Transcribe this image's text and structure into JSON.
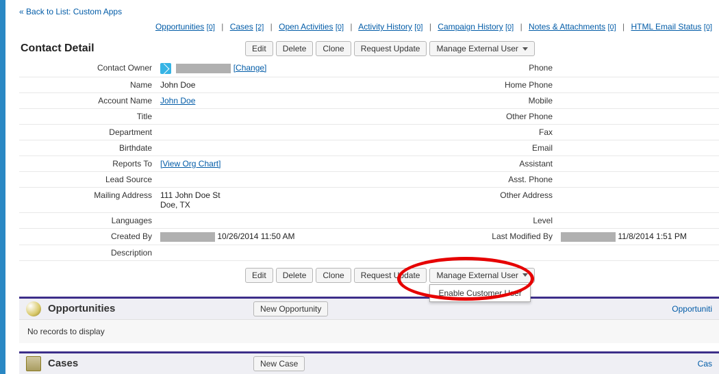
{
  "back_link": {
    "arrow": "«",
    "label": "Back to List: Custom Apps"
  },
  "related_nav": [
    {
      "label": "Opportunities",
      "count": "[0]"
    },
    {
      "label": "Cases",
      "count": "[2]"
    },
    {
      "label": "Open Activities",
      "count": "[0]"
    },
    {
      "label": "Activity History",
      "count": "[0]"
    },
    {
      "label": "Campaign History",
      "count": "[0]"
    },
    {
      "label": "Notes & Attachments",
      "count": "[0]"
    },
    {
      "label": "HTML Email Status",
      "count": "[0]"
    }
  ],
  "section_title": "Contact Detail",
  "buttons": {
    "edit": "Edit",
    "delete": "Delete",
    "clone": "Clone",
    "request_update": "Request Update",
    "manage_external": "Manage External User"
  },
  "dropdown": {
    "enable_customer_user": "Enable Customer User"
  },
  "fields": {
    "contact_owner_label": "Contact Owner",
    "change_link": "[Change]",
    "name_label": "Name",
    "name_value": "John Doe",
    "account_name_label": "Account Name",
    "account_name_value": "John Doe",
    "title_label": "Title",
    "department_label": "Department",
    "birthdate_label": "Birthdate",
    "reports_to_label": "Reports To",
    "reports_to_value": "[View Org Chart]",
    "lead_source_label": "Lead Source",
    "mailing_address_label": "Mailing Address",
    "mailing_address_value_l1": "111 John Doe St",
    "mailing_address_value_l2": "Doe, TX",
    "languages_label": "Languages",
    "created_by_label": "Created By",
    "created_by_value": "10/26/2014 11:50 AM",
    "description_label": "Description",
    "phone_label": "Phone",
    "home_phone_label": "Home Phone",
    "mobile_label": "Mobile",
    "other_phone_label": "Other Phone",
    "fax_label": "Fax",
    "email_label": "Email",
    "assistant_label": "Assistant",
    "asst_phone_label": "Asst. Phone",
    "other_address_label": "Other Address",
    "level_label": "Level",
    "last_modified_label": "Last Modified By",
    "last_modified_value": "11/8/2014 1:51 PM"
  },
  "related": {
    "opportunities_title": "Opportunities",
    "new_opp": "New Opportunity",
    "no_records": "No records to display",
    "opp_help": "Opportuniti",
    "cases_title": "Cases",
    "new_case": "New Case",
    "cases_help": "Cas"
  }
}
